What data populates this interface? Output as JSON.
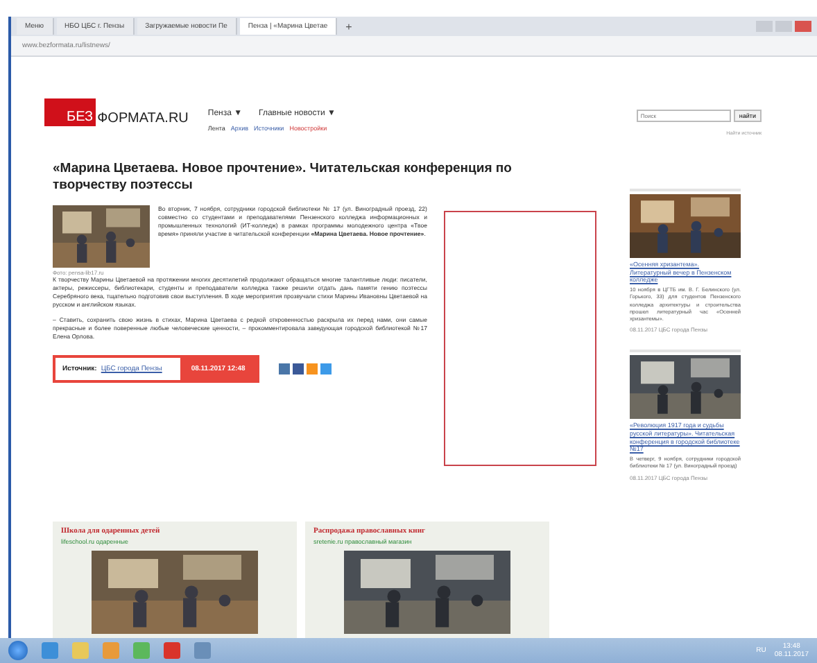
{
  "browser": {
    "tabs": [
      {
        "label": "Меню",
        "selected": false
      },
      {
        "label": "НБО ЦБС г. Пензы",
        "selected": false
      },
      {
        "label": "Загружаемые новости Пе",
        "selected": false
      },
      {
        "label": "Пенза | «Марина Цветае",
        "selected": true
      }
    ],
    "new_tab": "+",
    "address": "www.bezformata.ru/listnews/"
  },
  "site": {
    "logo_mark": "БЕЗ",
    "logo_text": "ФОРМАТА.RU",
    "nav": [
      {
        "label": "Пенза ▼"
      },
      {
        "label": "Главные новости ▼"
      }
    ],
    "subnav": [
      {
        "label": "Лента",
        "kind": "plain"
      },
      {
        "label": "Архив",
        "kind": "link"
      },
      {
        "label": "Источники",
        "kind": "link"
      },
      {
        "label": "Новостройки",
        "kind": "accent"
      }
    ],
    "search": {
      "placeholder": "Поиск",
      "button": "найти"
    },
    "find_source": "Найти источник"
  },
  "article": {
    "title": "«Марина Цветаева. Новое прочтение». Читательская конференция по творчеству поэтессы",
    "photo_caption": "Фото: pensa-lib17.ru",
    "paragraphs": [
      "Во вторник, 7 ноября, сотрудники городской библиотеки № 17 (ул. Виноградный проезд, 22) совместно со студентами и преподавателями Пензенского колледжа информационных и промышленных технологий (ИТ-колледж) в рамках программы молодежного центра «Твое время» приняли участие в читательской конференции **«Марина Цветаева. Новое прочтение»**.",
      "К творчеству Марины Цветаевой на протяжении многих десятилетий продолжают обращаться многие талантливые люди: писатели, актеры, режиссеры, библиотекари, студенты и преподаватели колледжа также решили отдать дань памяти гению поэтессы Серебряного века, тщательно подготовив свои выступления. В ходе мероприятия прозвучали стихи Марины Ивановны Цветаевой на русском и английском языках.",
      "– Ставить, сохранить свою жизнь в стихах, Марина Цветаева с редкой откровенностью раскрыла их перед нами, они самые прекрасные и более поверенные любые человеческие ценности, – прокомментировала заведующая городской библиотекой №17 Елена Орлова."
    ],
    "source_label": "Источник:",
    "source": "ЦБС города Пензы",
    "date": "08.11.2017 12:48"
  },
  "sidebar": [
    {
      "title": "«Осенняя хризантема». Литературный вечер в Пензенском колледже",
      "text": "10 ноября в ЦГТБ им. В. Г. Белинского (ул. Горького, 33) для студентов Пензенского колледжа архитектуры и строительства прошел литературный час «Осенней хризантемы».",
      "meta": "08.11.2017 ЦБС города Пензы"
    },
    {
      "title": "«Революция 1917 года и судьбы русской литературы». Читательская конференция в городской библиотеке №17",
      "text": "В четверг, 9 ноября, сотрудники городской библиотеки № 17 (ул. Виноградный проезд)",
      "meta": "08.11.2017 ЦБС города Пензы"
    }
  ],
  "ads": [
    {
      "title": "Школа для одаренных детей",
      "source": "lifeschool.ru одаренные"
    },
    {
      "title": "Распродажа православных книг",
      "source": "sretenie.ru православный магазин"
    }
  ],
  "taskbar": {
    "language": "RU",
    "time": "13:48",
    "date": "08.11.2017"
  }
}
